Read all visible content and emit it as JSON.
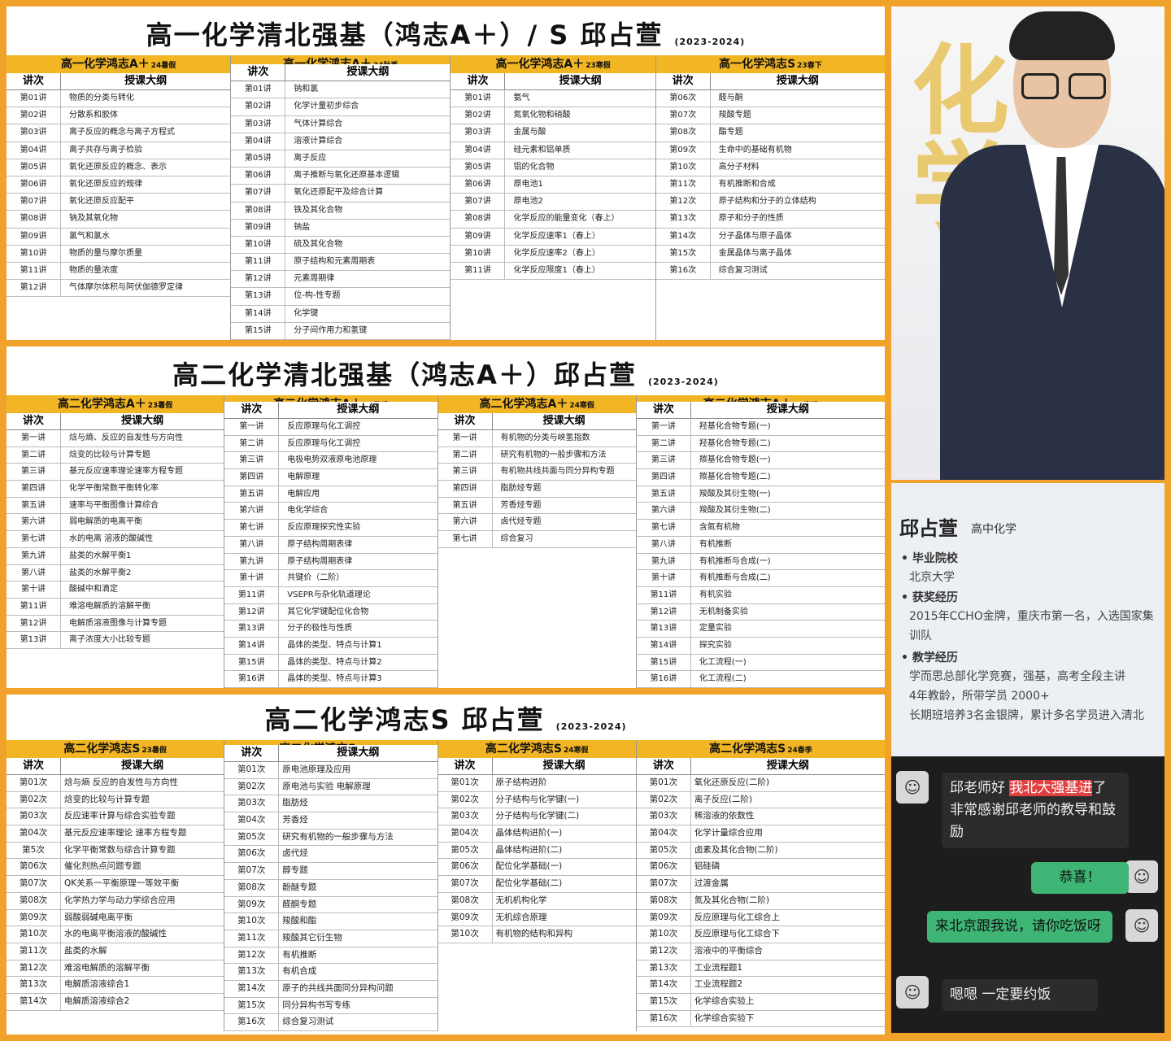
{
  "panel1": {
    "title": "高一化学清北强基（鸿志A＋）/ S 邱占萱",
    "year": "(2023-2024)",
    "columns": [
      {
        "head": "高一化学鸿志A＋",
        "tag": "24暑假",
        "h1": "讲次",
        "h2": "授课大纲",
        "rows": [
          [
            "第01讲",
            "物质的分类与转化"
          ],
          [
            "第02讲",
            "分散系和胶体"
          ],
          [
            "第03讲",
            "离子反应的概念与离子方程式"
          ],
          [
            "第04讲",
            "离子共存与离子检验"
          ],
          [
            "第05讲",
            "氧化还原反应的概念、表示"
          ],
          [
            "第06讲",
            "氧化还原反应的规律"
          ],
          [
            "第07讲",
            "氧化还原反应配平"
          ],
          [
            "第08讲",
            "钠及其氧化物"
          ],
          [
            "第09讲",
            "氯气和氯水"
          ],
          [
            "第10讲",
            "物质的量与摩尔质量"
          ],
          [
            "第11讲",
            "物质的量浓度"
          ],
          [
            "第12讲",
            "气体摩尔体积与阿伏伽德罗定律"
          ]
        ]
      },
      {
        "head": "高一化学鸿志A＋",
        "tag": "24秋季",
        "h1": "讲次",
        "h2": "授课大纲",
        "rows": [
          [
            "第01讲",
            "钠和氯"
          ],
          [
            "第02讲",
            "化学计量初步综合"
          ],
          [
            "第03讲",
            "气体计算综合"
          ],
          [
            "第04讲",
            "溶液计算综合"
          ],
          [
            "第05讲",
            "离子反应"
          ],
          [
            "第06讲",
            "离子推断与氧化还原基本逻辑"
          ],
          [
            "第07讲",
            "氧化还原配平及综合计算"
          ],
          [
            "第08讲",
            "铁及其化合物"
          ],
          [
            "第09讲",
            "钠盐"
          ],
          [
            "第10讲",
            "硫及其化合物"
          ],
          [
            "第11讲",
            "原子结构和元素周期表"
          ],
          [
            "第12讲",
            "元素周期律"
          ],
          [
            "第13讲",
            "位-构-性专题"
          ],
          [
            "第14讲",
            "化学键"
          ],
          [
            "第15讲",
            "分子间作用力和氢键"
          ]
        ]
      },
      {
        "head": "高一化学鸿志A＋",
        "tag": "23寒假",
        "h1": "讲次",
        "h2": "授课大纲",
        "rows": [
          [
            "第01讲",
            "氨气"
          ],
          [
            "第02讲",
            "氮氧化物和硝酸"
          ],
          [
            "第03讲",
            "金属与酸"
          ],
          [
            "第04讲",
            "硅元素和铝单质"
          ],
          [
            "第05讲",
            "铝的化合物"
          ],
          [
            "第06讲",
            "原电池1"
          ],
          [
            "第07讲",
            "原电池2"
          ],
          [
            "第08讲",
            "化学反应的能量变化（春上）"
          ],
          [
            "第09讲",
            "化学反应速率1（春上）"
          ],
          [
            "第10讲",
            "化学反应速率2（春上）"
          ],
          [
            "第11讲",
            "化学反应限度1（春上）"
          ]
        ]
      },
      {
        "head": "高一化学鸿志S",
        "tag": "23春下",
        "h1": "讲次",
        "h2": "授课大纲",
        "rows": [
          [
            "第06次",
            "醛与酮"
          ],
          [
            "第07次",
            "羧酸专题"
          ],
          [
            "第08次",
            "酯专题"
          ],
          [
            "第09次",
            "生命中的基础有机物"
          ],
          [
            "第10次",
            "高分子材料"
          ],
          [
            "第11次",
            "有机推断和合成"
          ],
          [
            "第12次",
            "原子结构和分子的立体结构"
          ],
          [
            "第13次",
            "原子和分子的性质"
          ],
          [
            "第14次",
            "分子晶体与原子晶体"
          ],
          [
            "第15次",
            "金属晶体与离子晶体"
          ],
          [
            "第16次",
            "综合复习测试"
          ]
        ]
      }
    ]
  },
  "panel2": {
    "title": "高二化学清北强基（鸿志A＋）邱占萱",
    "year": "(2023-2024)",
    "columns": [
      {
        "head": "高二化学鸿志A＋",
        "tag": "23暑假",
        "h1": "讲次",
        "h2": "授课大纲",
        "rows": [
          [
            "第一讲",
            "焓与熵、反应的自发性与方向性"
          ],
          [
            "第二讲",
            "焓变的比较与计算专题"
          ],
          [
            "第三讲",
            "基元反应速率理论速率方程专题"
          ],
          [
            "第四讲",
            "化学平衡常数平衡转化率"
          ],
          [
            "第五讲",
            "速率与平衡图像计算综合"
          ],
          [
            "第六讲",
            "弱电解质的电离平衡"
          ],
          [
            "第七讲",
            "水的电离 溶液的酸碱性"
          ],
          [
            "第九讲",
            "盐类的水解平衡1"
          ],
          [
            "第八讲",
            "盐类的水解平衡2"
          ],
          [
            "第十讲",
            "酸碱中和滴定"
          ],
          [
            "第11讲",
            "难溶电解质的溶解平衡"
          ],
          [
            "第12讲",
            "电解质溶液图像与计算专题"
          ],
          [
            "第13讲",
            "离子浓度大小比较专题"
          ]
        ]
      },
      {
        "head": "高二化学鸿志A＋",
        "tag": "23秋季",
        "h1": "讲次",
        "h2": "授课大纲",
        "rows": [
          [
            "第一讲",
            "反应原理与化工调控"
          ],
          [
            "第二讲",
            "反应原理与化工调控"
          ],
          [
            "第三讲",
            "电极电势双液原电池原理"
          ],
          [
            "第四讲",
            "电解原理"
          ],
          [
            "第五讲",
            "电解应用"
          ],
          [
            "第六讲",
            "电化学综合"
          ],
          [
            "第七讲",
            "反应原理探究性实验"
          ],
          [
            "第八讲",
            "原子结构周期表律"
          ],
          [
            "第九讲",
            "原子结构周期表律"
          ],
          [
            "第十讲",
            "共键价（二阶）"
          ],
          [
            "第11讲",
            "VSEPR与杂化轨道理论"
          ],
          [
            "第12讲",
            "其它化学键配位化合物"
          ],
          [
            "第13讲",
            "分子的极性与性质"
          ],
          [
            "第14讲",
            "晶体的类型、特点与计算1"
          ],
          [
            "第15讲",
            "晶体的类型、特点与计算2"
          ],
          [
            "第16讲",
            "晶体的类型、特点与计算3"
          ]
        ]
      },
      {
        "head": "高二化学鸿志A＋",
        "tag": "24寒假",
        "h1": "讲次",
        "h2": "授课大纲",
        "rows": [
          [
            "第一讲",
            "有机物的分类与峡氢指数"
          ],
          [
            "第二讲",
            "研究有机物的一般步骤和方法"
          ],
          [
            "第三讲",
            "有机物共线共面与同分异构专题"
          ],
          [
            "第四讲",
            "脂肪烃专题"
          ],
          [
            "第五讲",
            "芳香烃专题"
          ],
          [
            "第六讲",
            "卤代烃专题"
          ],
          [
            "第七讲",
            "综合复习"
          ]
        ]
      },
      {
        "head": "高二化学鸿志A＋",
        "tag": "24春季",
        "h1": "讲次",
        "h2": "授课大纲",
        "rows": [
          [
            "第一讲",
            "羟基化合物专题(一)"
          ],
          [
            "第二讲",
            "羟基化合物专题(二)"
          ],
          [
            "第三讲",
            "羰基化合物专题(一)"
          ],
          [
            "第四讲",
            "羰基化合物专题(二)"
          ],
          [
            "第五讲",
            "羧酸及其衍生物(一)"
          ],
          [
            "第六讲",
            "羧酸及其衍生物(二)"
          ],
          [
            "第七讲",
            "含氮有机物"
          ],
          [
            "第八讲",
            "有机推断"
          ],
          [
            "第九讲",
            "有机推断与合成(一)"
          ],
          [
            "第十讲",
            "有机推断与合成(二)"
          ],
          [
            "第11讲",
            "有机实验"
          ],
          [
            "第12讲",
            "无机制备实验"
          ],
          [
            "第13讲",
            "定量实验"
          ],
          [
            "第14讲",
            "探究实验"
          ],
          [
            "第15讲",
            "化工流程(一)"
          ],
          [
            "第16讲",
            "化工流程(二)"
          ]
        ]
      }
    ]
  },
  "panel3": {
    "title": "高二化学鸿志S  邱占萱",
    "year": "(2023-2024)",
    "columns": [
      {
        "head": "高二化学鸿志S",
        "tag": "23暑假",
        "h1": "讲次",
        "h2": "授课大纲",
        "rows": [
          [
            "第01次",
            "焓与熵 反应的自发性与方向性"
          ],
          [
            "第02次",
            "焓变的比较与计算专题"
          ],
          [
            "第03次",
            "反应速率计算与综合实验专题"
          ],
          [
            "第04次",
            "基元反应速率理论 速率方程专题"
          ],
          [
            "第5次",
            "化学平衡常数与综合计算专题"
          ],
          [
            "第06次",
            "催化剂热点问题专题"
          ],
          [
            "第07次",
            "QK关系一平衡原理一等效平衡"
          ],
          [
            "第08次",
            "化学热力学与动力学综合应用"
          ],
          [
            "第09次",
            "弱酸弱碱电离平衡"
          ],
          [
            "第10次",
            "水的电离平衡溶液的酸碱性"
          ],
          [
            "第11次",
            "盐类的水解"
          ],
          [
            "第12次",
            "难溶电解质的溶解平衡"
          ],
          [
            "第13次",
            "电解质溶液综合1"
          ],
          [
            "第14次",
            "电解质溶液综合2"
          ]
        ]
      },
      {
        "head": "高二化学鸿志S",
        "tag": "23秋季",
        "h1": "讲次",
        "h2": "授课大纲",
        "rows": [
          [
            "第01次",
            "原电池原理及应用"
          ],
          [
            "第02次",
            "原电池与实验 电解原理"
          ],
          [
            "第03次",
            "脂肪烃"
          ],
          [
            "第04次",
            "芳香烃"
          ],
          [
            "第05次",
            "研究有机物的一般步骤与方法"
          ],
          [
            "第06次",
            "卤代烃"
          ],
          [
            "第07次",
            "醇专题"
          ],
          [
            "第08次",
            "酚醚专题"
          ],
          [
            "第09次",
            "醛酮专题"
          ],
          [
            "第10次",
            "羧酸和酯"
          ],
          [
            "第11次",
            "羧酸其它衍生物"
          ],
          [
            "第12次",
            "有机推断"
          ],
          [
            "第13次",
            "有机合成"
          ],
          [
            "第14次",
            "原子的共线共面同分异构问题"
          ],
          [
            "第15次",
            "同分异构书写专练"
          ],
          [
            "第16次",
            "综合复习测试"
          ]
        ]
      },
      {
        "head": "高二化学鸿志S",
        "tag": "24寒假",
        "h1": "讲次",
        "h2": "授课大纲",
        "rows": [
          [
            "第01次",
            "原子结构进阶"
          ],
          [
            "第02次",
            "分子结构与化学键(一)"
          ],
          [
            "第03次",
            "分子结构与化学键(二)"
          ],
          [
            "第04次",
            "晶体结构进阶(一)"
          ],
          [
            "第05次",
            "晶体结构进阶(二)"
          ],
          [
            "第06次",
            "配位化学基础(一)"
          ],
          [
            "第07次",
            "配位化学基础(二)"
          ],
          [
            "第08次",
            "无机机构化学"
          ],
          [
            "第09次",
            "无机综合原理"
          ],
          [
            "第10次",
            "有机物的结构和异构"
          ]
        ]
      },
      {
        "head": "高二化学鸿志S",
        "tag": "24春季",
        "h1": "讲次",
        "h2": "授课大纲",
        "rows": [
          [
            "第01次",
            "氧化还原反应(二阶)"
          ],
          [
            "第02次",
            "离子反应(二阶)"
          ],
          [
            "第03次",
            "稀溶液的依数性"
          ],
          [
            "第04次",
            "化学计量综合应用"
          ],
          [
            "第05次",
            "卤素及其化合物(二阶)"
          ],
          [
            "第06次",
            "铝硅磷"
          ],
          [
            "第07次",
            "过渡金属"
          ],
          [
            "第08次",
            "氮及其化合物(二阶)"
          ],
          [
            "第09次",
            "反应原理与化工综合上"
          ],
          [
            "第10次",
            "反应原理与化工综合下"
          ],
          [
            "第12次",
            "溶液中的平衡综合"
          ],
          [
            "第13次",
            "工业流程题1"
          ],
          [
            "第14次",
            "工业流程题2"
          ],
          [
            "第15次",
            "化学综合实验上"
          ],
          [
            "第16次",
            "化学综合实验下"
          ]
        ]
      }
    ]
  },
  "profile": {
    "deco": "化学",
    "name": "邱占萱",
    "role": "高中化学",
    "school_label": "毕业院校",
    "school": "北京大学",
    "award_label": "获奖经历",
    "award": "2015年CCHO金牌，重庆市第一名，入选国家集训队",
    "teach_label": "教学经历",
    "teach1": "学而思总部化学竞赛，强基，高考全段主讲",
    "teach2": "4年教龄，所带学员 2000+",
    "teach3": "长期班培养3名金银牌，累计多名学员进入清北"
  },
  "chat": {
    "m1_pre": "邱老师好 ",
    "m1_hl": "我北大强基进",
    "m1_post": "了",
    "m1_line2": "非常感谢邱老师的教导和鼓励",
    "m2": "恭喜！",
    "m3": "来北京跟我说，请你吃饭呀",
    "m4": "嗯嗯 一定要约饭"
  }
}
